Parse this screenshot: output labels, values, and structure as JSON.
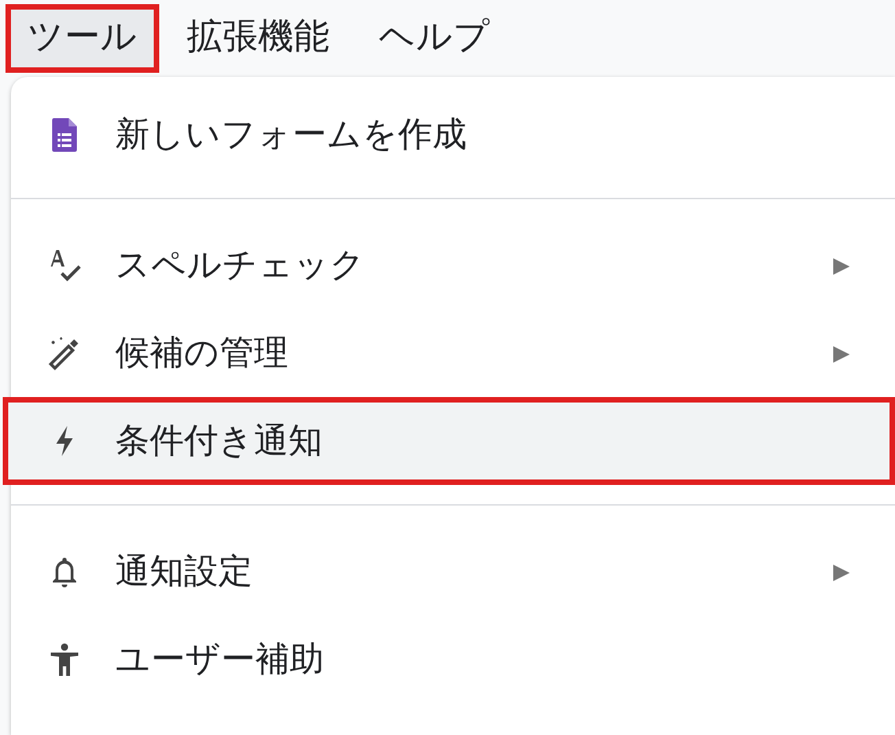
{
  "menubar": [
    {
      "label": "ツール",
      "selected": true
    },
    {
      "label": "拡張機能",
      "selected": false
    },
    {
      "label": "ヘルプ",
      "selected": false
    }
  ],
  "menu": {
    "sections": [
      {
        "items": [
          {
            "label": "新しいフォームを作成",
            "submenu": false,
            "selected": false
          }
        ]
      },
      {
        "items": [
          {
            "label": "スペルチェック",
            "submenu": true,
            "selected": false
          },
          {
            "label": "候補の管理",
            "submenu": true,
            "selected": false
          },
          {
            "label": "条件付き通知",
            "submenu": false,
            "selected": true
          }
        ]
      },
      {
        "items": [
          {
            "label": "通知設定",
            "submenu": true,
            "selected": false
          },
          {
            "label": "ユーザー補助",
            "submenu": false,
            "selected": false
          }
        ]
      }
    ]
  }
}
